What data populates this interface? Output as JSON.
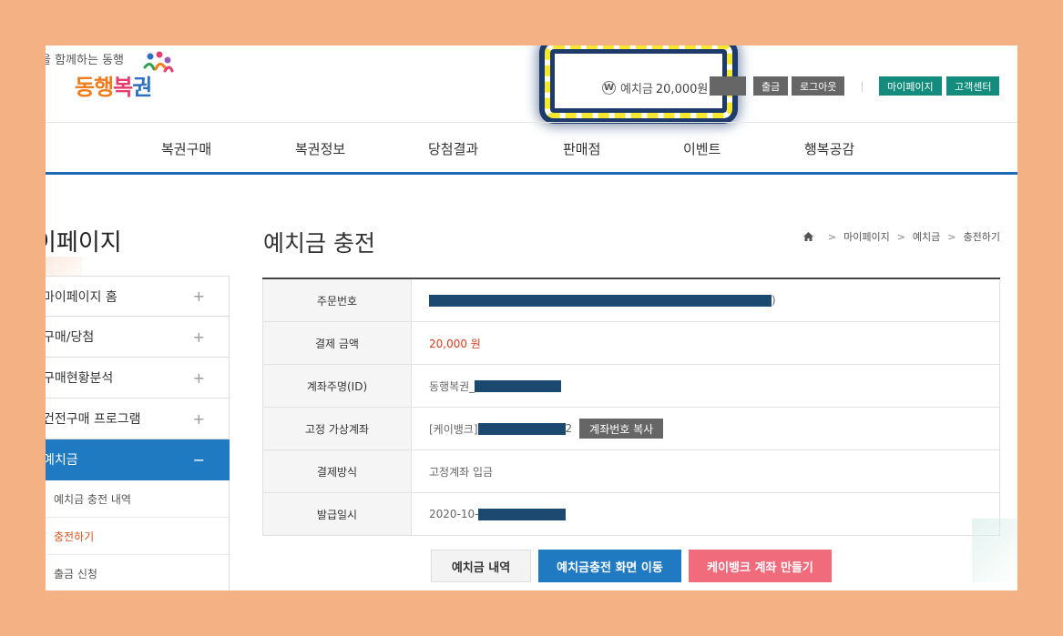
{
  "header": {
    "tagline": "을 함께하는 동행",
    "logo_text": [
      "동행",
      "복",
      "권"
    ],
    "deposit_icon": "W",
    "deposit_label": "예치금",
    "deposit_amount": "20,000원",
    "buttons": {
      "withdraw": "출금",
      "logout": "로그아웃",
      "mypage": "마이페이지",
      "support": "고객센터"
    }
  },
  "nav": [
    "복권구매",
    "복권정보",
    "당첨결과",
    "판매점",
    "이벤트",
    "행복공감"
  ],
  "sidebar": {
    "title": "이페이지",
    "items": [
      {
        "label": "마이페이지 홈",
        "toggle": "+"
      },
      {
        "label": "구매/당첨",
        "toggle": "+"
      },
      {
        "label": "구매현황분석",
        "toggle": "+"
      },
      {
        "label": "건전구매 프로그램",
        "toggle": "+"
      },
      {
        "label": "예치금",
        "toggle": "−"
      }
    ],
    "subitems": [
      "예치금 충전 내역",
      "충전하기",
      "출금 신청"
    ]
  },
  "main": {
    "title": "예치금 충전",
    "breadcrumb": [
      "마이페이지",
      "예치금",
      "충전하기"
    ],
    "rows": [
      {
        "label": "주문번호",
        "value": ")"
      },
      {
        "label": "결제 금액",
        "value": "20,000 원"
      },
      {
        "label": "계좌주명(ID)",
        "value": "동행복권_"
      },
      {
        "label": "고정 가상계좌",
        "value": "[케이뱅크]",
        "value_suffix": "2"
      },
      {
        "label": "결제방식",
        "value": "고정계좌 입금"
      },
      {
        "label": "발급일시",
        "value": "2020-10-"
      }
    ],
    "copy_button": "계좌번호 복사",
    "actions": {
      "history": "예치금 내역",
      "charge": "예치금충전 화면 이동",
      "kbank": "케이뱅크 계좌 만들기"
    }
  },
  "colors": {
    "accent_blue": "#1f7ac2",
    "header_green": "#138c7e",
    "pink": "#f06b7c",
    "highlight_yellow": "#f5e82f",
    "frame": "#f4b183"
  }
}
